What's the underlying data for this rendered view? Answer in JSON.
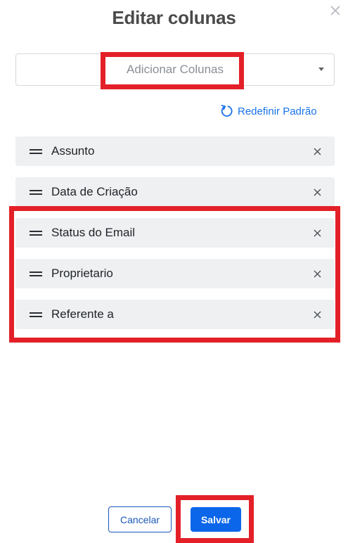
{
  "dialog": {
    "title": "Editar colunas",
    "close_icon": "close-icon"
  },
  "add_columns": {
    "placeholder": "Adicionar Colunas",
    "caret_icon": "caret-down-icon"
  },
  "reset": {
    "label": "Redefinir Padrão",
    "icon": "reset-icon"
  },
  "columns": [
    {
      "label": "Assunto"
    },
    {
      "label": "Data de Criação"
    },
    {
      "label": "Status do Email"
    },
    {
      "label": "Proprietario"
    },
    {
      "label": "Referente a"
    }
  ],
  "footer": {
    "cancel_label": "Cancelar",
    "save_label": "Salvar"
  },
  "colors": {
    "accent": "#0b66ea",
    "link": "#1a73e8",
    "highlight": "#e32028",
    "item_bg": "#eef0f2"
  }
}
